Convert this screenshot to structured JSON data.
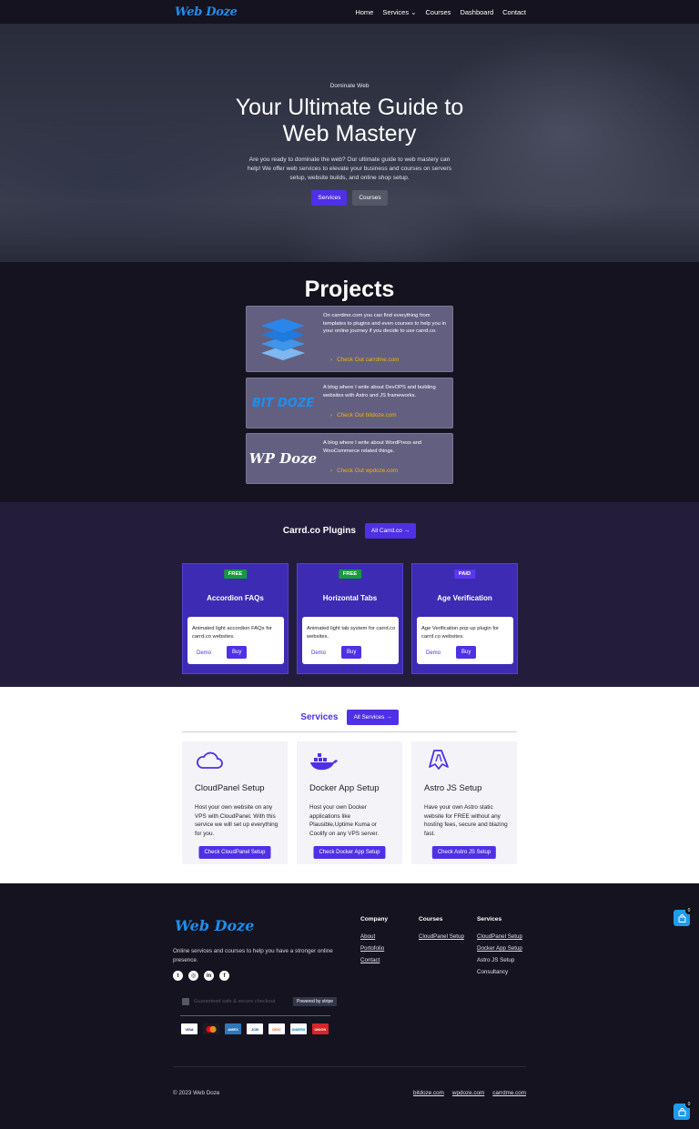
{
  "header": {
    "logo": "Web Doze",
    "nav": [
      "Home",
      "Services",
      "Courses",
      "Dashboard",
      "Contact"
    ]
  },
  "hero": {
    "eyebrow": "Dominate Web",
    "title": "Your Ultimate Guide to Web Mastery",
    "description": "Are you ready to dominate the web? Our ultimate guide to web mastery can help! We offer web services to elevate your business and courses on servers setup, website builds, and online shop setup.",
    "primary_button": "Services",
    "secondary_button": "Courses"
  },
  "projects": {
    "title": "Projects",
    "items": [
      {
        "logo": "carrdme-stack-logo",
        "description": "On carrdme.com you can find everything from templates to plugins and even courses to help you in your online journey if you decide to use carrd.co.",
        "link": "Check Out carrdme.com"
      },
      {
        "logo": "BIT DOZE",
        "description": "A blog where I write about DevOPS and building websites with Astro and JS frameworks.",
        "link": "Check Out bitdoze.com"
      },
      {
        "logo": "WP Doze",
        "description": "A blog where I write about WordPress and WooCommerce related things.",
        "link": "Check Out wpdoze.com"
      }
    ]
  },
  "plugins": {
    "title": "Carrd.co Plugins",
    "all_button": "All Carrd.co →",
    "items": [
      {
        "badge": "FREE",
        "name": "Accordion FAQs",
        "description": "Animated light accordion FAQs for carrd.co websites.",
        "demo": "Demo",
        "buy": "Buy"
      },
      {
        "badge": "FREE",
        "name": "Horizontal Tabs",
        "description": "Animated light tab system for carrd.co websites.",
        "demo": "Demo",
        "buy": "Buy"
      },
      {
        "badge": "PAID",
        "name": "Age Verification",
        "description": "Age Verification pop up plugin for carrd.co websites.",
        "demo": "Demo",
        "buy": "Buy"
      }
    ]
  },
  "services": {
    "title": "Services",
    "all_button": "All Services →",
    "items": [
      {
        "icon": "cloud-icon",
        "title": "CloudPanel Setup",
        "description": "Host your own website on any VPS with CloudPanel. With this service we will set up everything for you.",
        "button": "Check CloudPanel Setup"
      },
      {
        "icon": "docker-icon",
        "title": "Docker App Setup",
        "description": "Host your own Docker applications like Plausible,Uptime Kuma or Coolify on any VPS server.",
        "button": "Check Docker App Setup"
      },
      {
        "icon": "astro-icon",
        "title": "Astro JS Setup",
        "description": "Have your own Astro static website for FREE without any hosting fees, secure and blazing fast.",
        "button": "Check Astro JS Setup"
      }
    ]
  },
  "footer": {
    "logo": "Web Doze",
    "tagline": "Online services and courses to help you have a stronger online presence.",
    "social": [
      "twitter-icon",
      "instagram-icon",
      "linkedin-icon",
      "facebook-icon"
    ],
    "secure_text": "Guaranteed safe & secure checkout",
    "stripe_badge": "Powered by stripe",
    "cards": [
      "VISA",
      "MC",
      "AMEX",
      "JCB",
      "DISC",
      "DINERS",
      "UNION"
    ],
    "columns": [
      {
        "heading": "Company",
        "links": [
          "About",
          "Portofolio",
          "Contact"
        ]
      },
      {
        "heading": "Courses",
        "links": [
          "CloudPanel Setup"
        ]
      },
      {
        "heading": "Services",
        "links": [
          "CloudPanel Setup",
          "Docker App Setup",
          "Astro JS Setup",
          "Consultancy"
        ]
      }
    ],
    "copyright": "© 2023 Web Doze",
    "bottom_links": [
      "bitdoze.com",
      "wpdoze.com",
      "carrdme.com"
    ]
  },
  "cart": {
    "count": "0"
  }
}
